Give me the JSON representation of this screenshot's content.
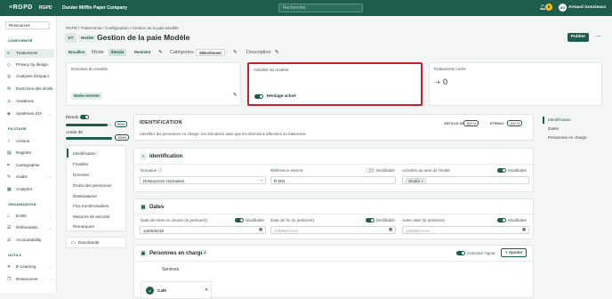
{
  "topbar": {
    "logo": "≡RGPD",
    "org": "RGPD",
    "company": "Dunder Mifflin Paper Company",
    "search_placeholder": "Rechercher",
    "notif_count": "6",
    "avatar": "AG",
    "user": "Arnaud Gossieaux"
  },
  "sidebar": {
    "select": "Ressources",
    "sections": [
      {
        "label": "CONFORMITÉ"
      },
      {
        "label": "PILOTAGE"
      },
      {
        "label": "ORGANISATION"
      },
      {
        "label": "OUTILS"
      }
    ],
    "items": [
      {
        "label": "Traitements",
        "icon": "≡"
      },
      {
        "label": "Privacy by design",
        "icon": "◇"
      },
      {
        "label": "Analyses d'impact",
        "icon": "◎"
      },
      {
        "label": "Exercices des droits",
        "icon": "✉"
      },
      {
        "label": "Violations",
        "icon": "⚠"
      },
      {
        "label": "Systèmes d'IA",
        "icon": "◈"
      },
      {
        "label": "Actions",
        "icon": "✓"
      },
      {
        "label": "Registre",
        "icon": "▤"
      },
      {
        "label": "Cartographie",
        "icon": "⌗"
      },
      {
        "label": "Audits",
        "icon": "✎"
      },
      {
        "label": "Analytics",
        "icon": "▦"
      },
      {
        "label": "Entité",
        "icon": "⌂"
      },
      {
        "label": "Référentiels",
        "icon": "☰"
      },
      {
        "label": "Accountability",
        "icon": "⚖"
      },
      {
        "label": "E-Learning",
        "icon": "✦"
      },
      {
        "label": "Ressources",
        "icon": "❐"
      }
    ]
  },
  "breadcrumb": "RGPD / Traitements / Configuration / Gestion de la paie Modèle",
  "header": {
    "kt": "KT",
    "modele": "Modèle",
    "title": "Gestion de la paie Modèle",
    "publish": "Publier"
  },
  "tags": {
    "brouillon": "Brouillon",
    "mode": "Mode",
    "etendu": "Étendu",
    "restreint": "Restreint",
    "categories": "Catégories",
    "select": "Sélectionner",
    "description": "Description"
  },
  "cards": {
    "model_data": "Données du modèle",
    "mode_restreint": "Mode restreint",
    "visibility": "Visibilité du modèle",
    "heritage": "Héritage activé",
    "treatments": "Traitements créés",
    "treatments_count": "0"
  },
  "progress": {
    "etendu": "Étendu",
    "article30": "Article 30",
    "p1": "90%",
    "p2": "100%",
    "v1": 0.9,
    "v2": 1.0
  },
  "leftnav": [
    "Identification",
    "Finalités",
    "Données",
    "Droits des personnes",
    "Destinataires",
    "Flux transfrontaliers",
    "Mesures de sécurité",
    "Remarques"
  ],
  "documents": "Documents",
  "ident": {
    "heading": "IDENTIFICATION",
    "desc": "Identifiez les personnes en charge, les domaines ainsi que les directions affectées au traitement",
    "art30": "ARTICLE 30",
    "art30_pct": "100 %",
    "etendu": "ÉTENDU",
    "etendu_pct": "100 %"
  },
  "ident_card": {
    "title": "Identification",
    "domaine": "Domaine",
    "domaine_val": "Ressources Humaines",
    "ref": "Référence interne",
    "modifiable": "Modifiable",
    "ref_val": "R-001",
    "activity": "Activités au sein de l'entité",
    "activity_val": "Studio ×"
  },
  "dates": {
    "title": "Dates",
    "start": "Date de mise en œuvre (si pertinent)",
    "start_val": "14/05/2018",
    "end": "Date de fin (si pertinent)",
    "end_ph": "JJ/MM/AAAA",
    "other": "Autre date (si pertinent)",
    "other_ph": "JJ/MM/AAAA"
  },
  "persons": {
    "title": "Personnes en charge",
    "count": "1",
    "autoriser": "Autoriser l'ajout",
    "add": "+ Ajouter",
    "services": "Services",
    "cafe": "Café"
  },
  "toc": [
    "Identification",
    "Dates",
    "Personnes en charge"
  ]
}
